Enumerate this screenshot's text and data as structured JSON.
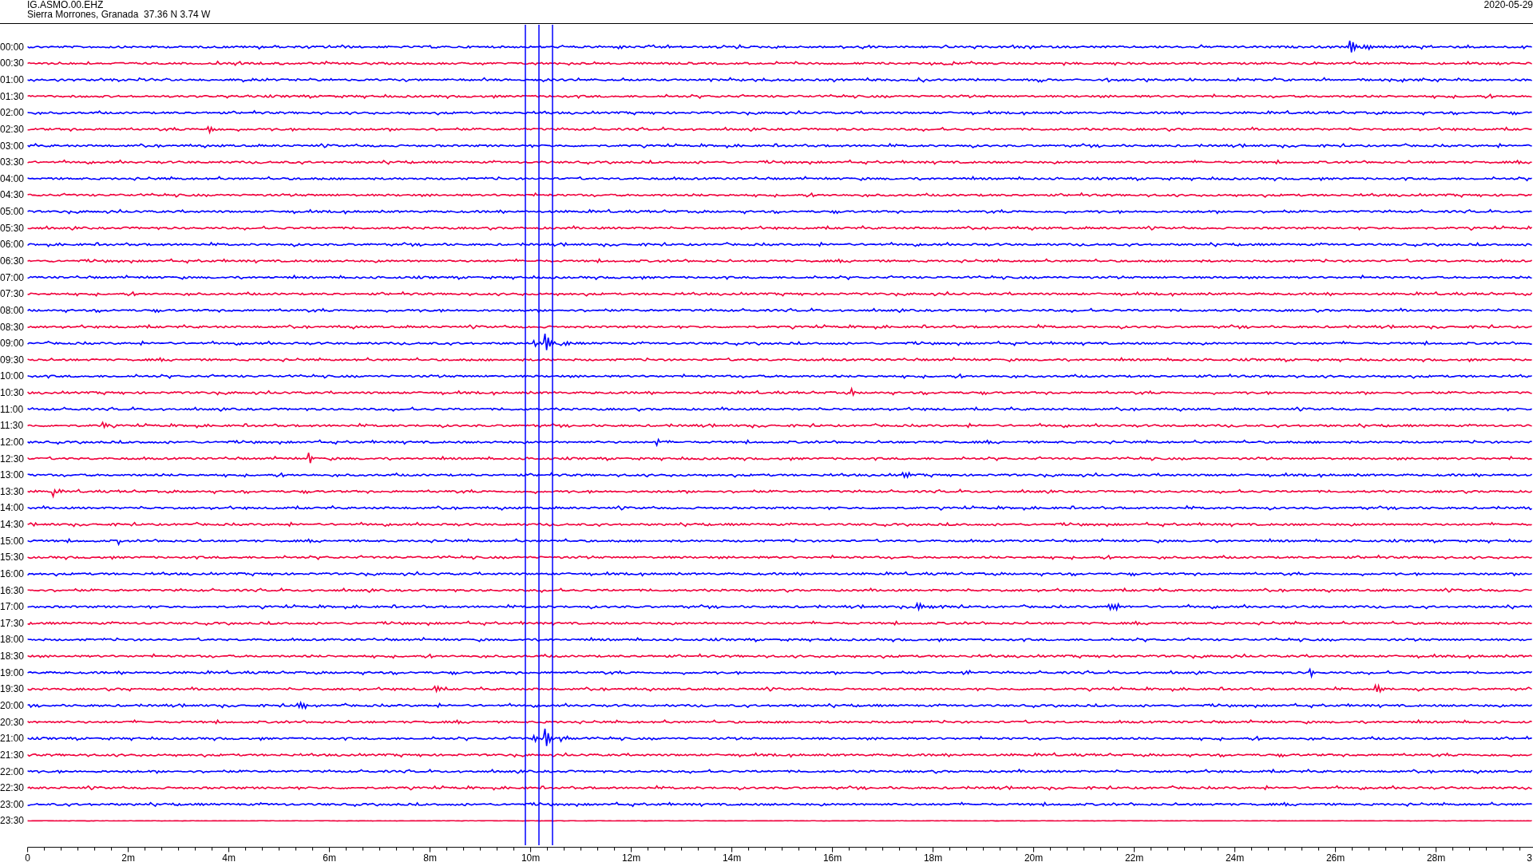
{
  "header": {
    "station": "IG.ASMO.00.EHZ",
    "location": "Sierra Morrones, Granada  37.36 N 3.74 W",
    "date": "2020-05-29"
  },
  "traces": [
    {
      "label": "00:00",
      "color": "#0000ff"
    },
    {
      "label": "00:30",
      "color": "#f0003c"
    },
    {
      "label": "01:00",
      "color": "#0000ff"
    },
    {
      "label": "01:30",
      "color": "#f0003c"
    },
    {
      "label": "02:00",
      "color": "#0000ff"
    },
    {
      "label": "02:30",
      "color": "#f0003c"
    },
    {
      "label": "03:00",
      "color": "#0000ff"
    },
    {
      "label": "03:30",
      "color": "#f0003c"
    },
    {
      "label": "04:00",
      "color": "#0000ff"
    },
    {
      "label": "04:30",
      "color": "#f0003c"
    },
    {
      "label": "05:00",
      "color": "#0000ff"
    },
    {
      "label": "05:30",
      "color": "#f0003c"
    },
    {
      "label": "06:00",
      "color": "#0000ff"
    },
    {
      "label": "06:30",
      "color": "#f0003c"
    },
    {
      "label": "07:00",
      "color": "#0000ff"
    },
    {
      "label": "07:30",
      "color": "#f0003c"
    },
    {
      "label": "08:00",
      "color": "#0000ff"
    },
    {
      "label": "08:30",
      "color": "#f0003c"
    },
    {
      "label": "09:00",
      "color": "#0000ff"
    },
    {
      "label": "09:30",
      "color": "#f0003c"
    },
    {
      "label": "10:00",
      "color": "#0000ff"
    },
    {
      "label": "10:30",
      "color": "#f0003c"
    },
    {
      "label": "11:00",
      "color": "#0000ff"
    },
    {
      "label": "11:30",
      "color": "#f0003c"
    },
    {
      "label": "12:00",
      "color": "#0000ff"
    },
    {
      "label": "12:30",
      "color": "#f0003c"
    },
    {
      "label": "13:00",
      "color": "#0000ff"
    },
    {
      "label": "13:30",
      "color": "#f0003c"
    },
    {
      "label": "14:00",
      "color": "#0000ff"
    },
    {
      "label": "14:30",
      "color": "#f0003c"
    },
    {
      "label": "15:00",
      "color": "#0000ff"
    },
    {
      "label": "15:30",
      "color": "#f0003c"
    },
    {
      "label": "16:00",
      "color": "#0000ff"
    },
    {
      "label": "16:30",
      "color": "#f0003c"
    },
    {
      "label": "17:00",
      "color": "#0000ff"
    },
    {
      "label": "17:30",
      "color": "#f0003c"
    },
    {
      "label": "18:00",
      "color": "#0000ff"
    },
    {
      "label": "18:30",
      "color": "#f0003c"
    },
    {
      "label": "19:00",
      "color": "#0000ff"
    },
    {
      "label": "19:30",
      "color": "#f0003c"
    },
    {
      "label": "20:00",
      "color": "#0000ff"
    },
    {
      "label": "20:30",
      "color": "#f0003c"
    },
    {
      "label": "21:00",
      "color": "#0000ff"
    },
    {
      "label": "21:30",
      "color": "#f0003c"
    },
    {
      "label": "22:00",
      "color": "#0000ff"
    },
    {
      "label": "22:30",
      "color": "#f0003c"
    },
    {
      "label": "23:00",
      "color": "#0000ff"
    },
    {
      "label": "23:30",
      "color": "#f0003c"
    }
  ],
  "time_axis": {
    "ticks": [
      "0",
      "2m",
      "4m",
      "6m",
      "8m",
      "10m",
      "12m",
      "14m",
      "16m",
      "18m",
      "20m",
      "22m",
      "24m",
      "26m",
      "28m",
      "3"
    ]
  }
}
